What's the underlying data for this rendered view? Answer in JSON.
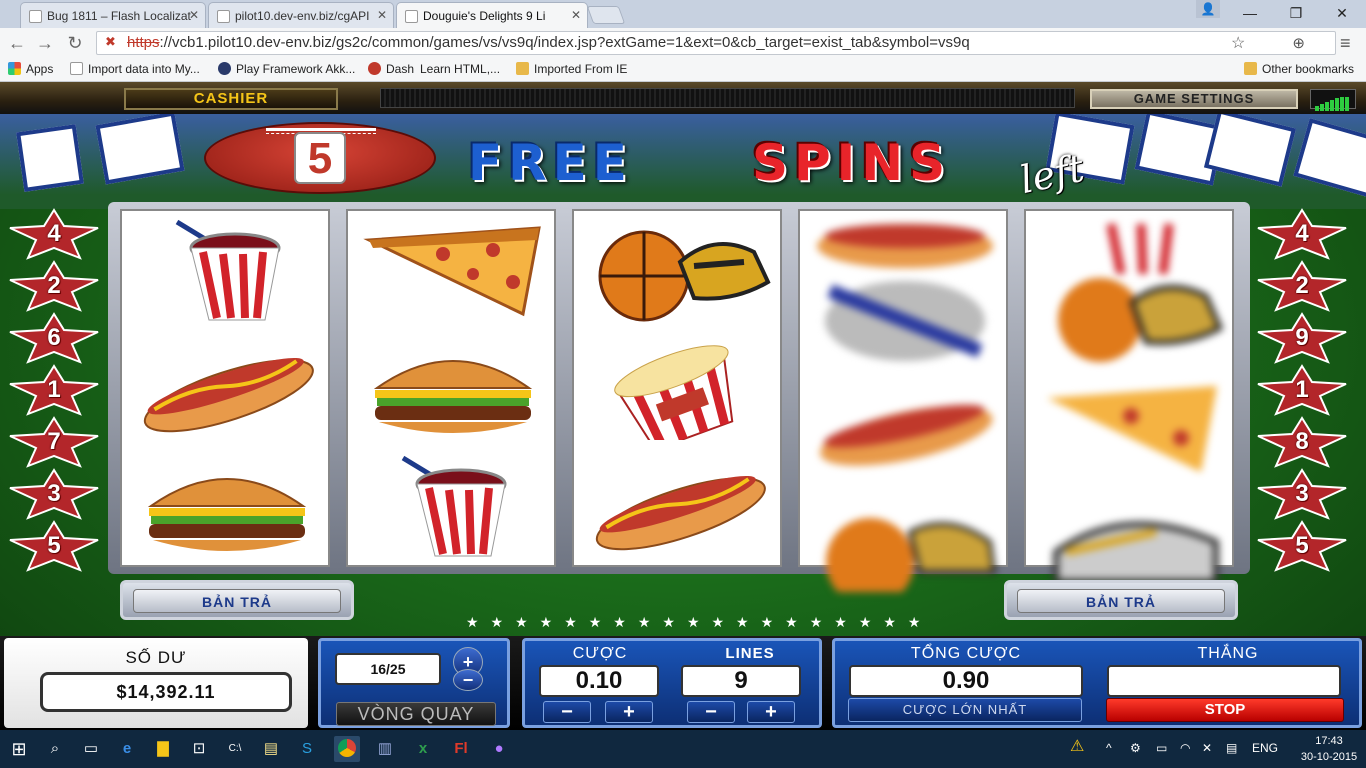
{
  "browser": {
    "tabs": [
      {
        "title": "Bug 1811 – Flash Localizat",
        "active": false
      },
      {
        "title": "pilot10.dev-env.biz/cgAPI",
        "active": false
      },
      {
        "title": "Douguie's Delights 9 Li",
        "active": true
      }
    ],
    "url_scheme": "https",
    "url_rest": "://vcb1.pilot10.dev-env.biz/gs2c/common/games/vs/vs9q/index.jsp?extGame=1&ext=0&cb_target=exist_tab&symbol=vs9q",
    "bookmarks": [
      "Apps",
      "Import data into My...",
      "Play Framework Akk...",
      "Dash",
      "Learn HTML,...",
      "Imported From IE"
    ],
    "other_bookmarks": "Other bookmarks"
  },
  "game": {
    "cashier_label": "CASHIER",
    "settings_label": "GAME SETTINGS",
    "free_spins_count": "5",
    "free_label": "FREE",
    "spins_label": "SPINS",
    "left_label": "left",
    "left_stars": [
      "4",
      "2",
      "6",
      "1",
      "7",
      "3",
      "5"
    ],
    "right_stars": [
      "4",
      "2",
      "9",
      "1",
      "8",
      "3",
      "5"
    ],
    "reels": [
      [
        "soda-cup",
        "hotdog",
        "burger"
      ],
      [
        "pizza",
        "burger",
        "soda-cup"
      ],
      [
        "basketball-shoe",
        "popcorn",
        "hotdog"
      ],
      [
        "hotdog-blurred",
        "hotdog-blurred",
        "basketball-blurred"
      ],
      [
        "basketball-blurred",
        "pizza-blurred",
        "shoe-blurred"
      ]
    ],
    "paytable_left": "BẢN TRẢ",
    "paytable_right": "BẢN TRẢ",
    "balance_label": "SỐ DƯ",
    "balance_value": "$14,392.11",
    "spin_counter": "16/25",
    "spin_label": "VÒNG QUAY",
    "bet_label": "CƯỢC",
    "bet_value": "0.10",
    "lines_label": "LINES",
    "lines_value": "9",
    "total_bet_label": "TỔNG CƯỢC",
    "total_bet_value": "0.90",
    "max_bet_label": "CƯỢC LỚN NHẤT",
    "win_label": "THẮNG",
    "win_value": "",
    "stop_label": "STOP"
  },
  "taskbar": {
    "language": "ENG",
    "time": "17:43",
    "date": "30-10-2015"
  },
  "colors": {
    "field_green": "#1a6a1a",
    "panel_blue": "#1a55b8",
    "star_red": "#b3262a",
    "stop_red": "#e00000",
    "gold": "#f5c518"
  }
}
